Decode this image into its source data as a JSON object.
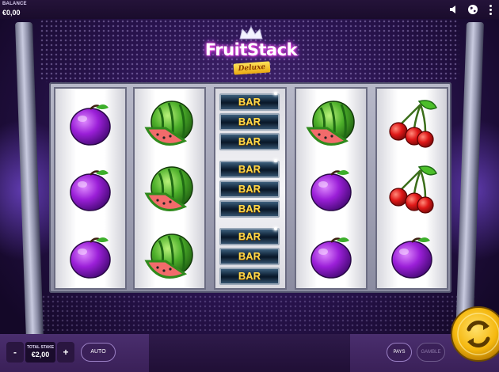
{
  "header": {
    "balance_label": "BALANCE",
    "balance_value": "€0,00",
    "icons": [
      "speaker-icon",
      "globe-icon",
      "menu-icon"
    ]
  },
  "logo": {
    "title": "FruitStack",
    "subtitle": "Deluxe"
  },
  "reels": [
    [
      "plum",
      "plum",
      "plum"
    ],
    [
      "watermelon",
      "watermelon",
      "watermelon"
    ],
    [
      "bar-stack",
      "bar-stack",
      "bar-stack"
    ],
    [
      "watermelon",
      "plum",
      "plum"
    ],
    [
      "cherries",
      "cherries",
      "plum"
    ]
  ],
  "bar_label": "BAR",
  "controls": {
    "minus_label": "-",
    "plus_label": "+",
    "total_stake_label": "TOTAL STAKE",
    "total_stake_value": "€2,00",
    "auto_label": "AUTO",
    "pays_label": "PAYS",
    "gamble_label": "GAMBLE",
    "spin_icon": "spin-icon"
  },
  "colors": {
    "accent_gold": "#f5b80f",
    "background_purple": "#2a1450",
    "bar_text": "#ffd84a"
  }
}
